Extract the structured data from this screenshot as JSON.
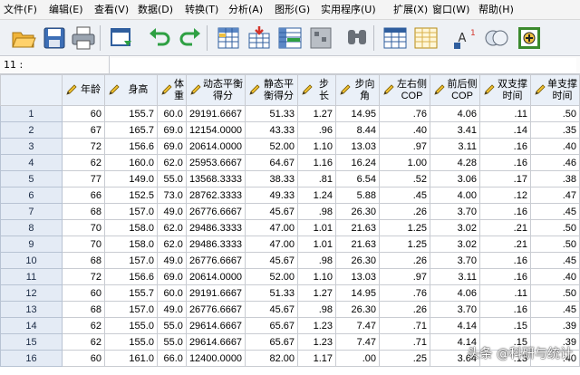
{
  "menu": [
    "文件(F)",
    "编辑(E)",
    "查看(V)",
    "数据(D)",
    "转换(T)",
    "分析(A)",
    "图形(G)",
    "实用程序(U)",
    "扩展(X)",
    "窗口(W)",
    "帮助(H)"
  ],
  "toolbar": [
    {
      "name": "open-file-icon"
    },
    {
      "name": "save-icon"
    },
    {
      "name": "print-icon"
    },
    {
      "name": "recall-dialog-icon"
    },
    {
      "name": "undo-icon"
    },
    {
      "name": "redo-icon"
    },
    {
      "name": "goto-case-icon"
    },
    {
      "name": "goto-variable-icon"
    },
    {
      "name": "variables-icon"
    },
    {
      "name": "run-descriptives-icon"
    },
    {
      "name": "find-icon"
    },
    {
      "name": "insert-cases-icon"
    },
    {
      "name": "insert-variable-icon"
    },
    {
      "name": "split-file-icon"
    },
    {
      "name": "weight-cases-icon"
    },
    {
      "name": "select-cases-icon"
    },
    {
      "name": "value-labels-icon"
    }
  ],
  "refbar": {
    "cell_ref": "11 :"
  },
  "columns": [
    "年龄",
    "身高",
    "体重",
    "动态平衡得分",
    "静态平衡得分",
    "步长",
    "步向角",
    "左右侧COP",
    "前后侧COP",
    "双支撑时间",
    "单支撑时间"
  ],
  "rows": [
    {
      "n": "1",
      "cells": [
        "60",
        "155.7",
        "60.0",
        "29191.6667",
        "51.33",
        "1.27",
        "14.95",
        ".76",
        "4.06",
        ".11",
        ".50"
      ]
    },
    {
      "n": "2",
      "cells": [
        "67",
        "165.7",
        "69.0",
        "12154.0000",
        "43.33",
        ".96",
        "8.44",
        ".40",
        "3.41",
        ".14",
        ".35"
      ]
    },
    {
      "n": "3",
      "cells": [
        "72",
        "156.6",
        "69.0",
        "20614.0000",
        "52.00",
        "1.10",
        "13.03",
        ".97",
        "3.11",
        ".16",
        ".40"
      ]
    },
    {
      "n": "4",
      "cells": [
        "62",
        "160.0",
        "62.0",
        "25953.6667",
        "64.67",
        "1.16",
        "16.24",
        "1.00",
        "4.28",
        ".16",
        ".46"
      ]
    },
    {
      "n": "5",
      "cells": [
        "77",
        "149.0",
        "55.0",
        "13568.3333",
        "38.33",
        ".81",
        "6.54",
        ".52",
        "3.06",
        ".17",
        ".38"
      ]
    },
    {
      "n": "6",
      "cells": [
        "66",
        "152.5",
        "73.0",
        "28762.3333",
        "49.33",
        "1.24",
        "5.88",
        ".45",
        "4.00",
        ".12",
        ".47"
      ]
    },
    {
      "n": "7",
      "cells": [
        "68",
        "157.0",
        "49.0",
        "26776.6667",
        "45.67",
        ".98",
        "26.30",
        ".26",
        "3.70",
        ".16",
        ".45"
      ]
    },
    {
      "n": "8",
      "cells": [
        "70",
        "158.0",
        "62.0",
        "29486.3333",
        "47.00",
        "1.01",
        "21.63",
        "1.25",
        "3.02",
        ".21",
        ".50"
      ]
    },
    {
      "n": "9",
      "cells": [
        "70",
        "158.0",
        "62.0",
        "29486.3333",
        "47.00",
        "1.01",
        "21.63",
        "1.25",
        "3.02",
        ".21",
        ".50"
      ]
    },
    {
      "n": "10",
      "cells": [
        "68",
        "157.0",
        "49.0",
        "26776.6667",
        "45.67",
        ".98",
        "26.30",
        ".26",
        "3.70",
        ".16",
        ".45"
      ]
    },
    {
      "n": "11",
      "cells": [
        "72",
        "156.6",
        "69.0",
        "20614.0000",
        "52.00",
        "1.10",
        "13.03",
        ".97",
        "3.11",
        ".16",
        ".40"
      ]
    },
    {
      "n": "12",
      "cells": [
        "60",
        "155.7",
        "60.0",
        "29191.6667",
        "51.33",
        "1.27",
        "14.95",
        ".76",
        "4.06",
        ".11",
        ".50"
      ]
    },
    {
      "n": "13",
      "cells": [
        "68",
        "157.0",
        "49.0",
        "26776.6667",
        "45.67",
        ".98",
        "26.30",
        ".26",
        "3.70",
        ".16",
        ".45"
      ]
    },
    {
      "n": "14",
      "cells": [
        "62",
        "155.0",
        "55.0",
        "29614.6667",
        "65.67",
        "1.23",
        "7.47",
        ".71",
        "4.14",
        ".15",
        ".39"
      ]
    },
    {
      "n": "15",
      "cells": [
        "62",
        "155.0",
        "55.0",
        "29614.6667",
        "65.67",
        "1.23",
        "7.47",
        ".71",
        "4.14",
        ".15",
        ".39"
      ]
    },
    {
      "n": "16",
      "cells": [
        "60",
        "161.0",
        "66.0",
        "12400.0000",
        "82.00",
        "1.17",
        ".00",
        ".25",
        "3.64",
        ".13",
        ".40"
      ]
    }
  ],
  "watermark": "头条 @科研与统计"
}
